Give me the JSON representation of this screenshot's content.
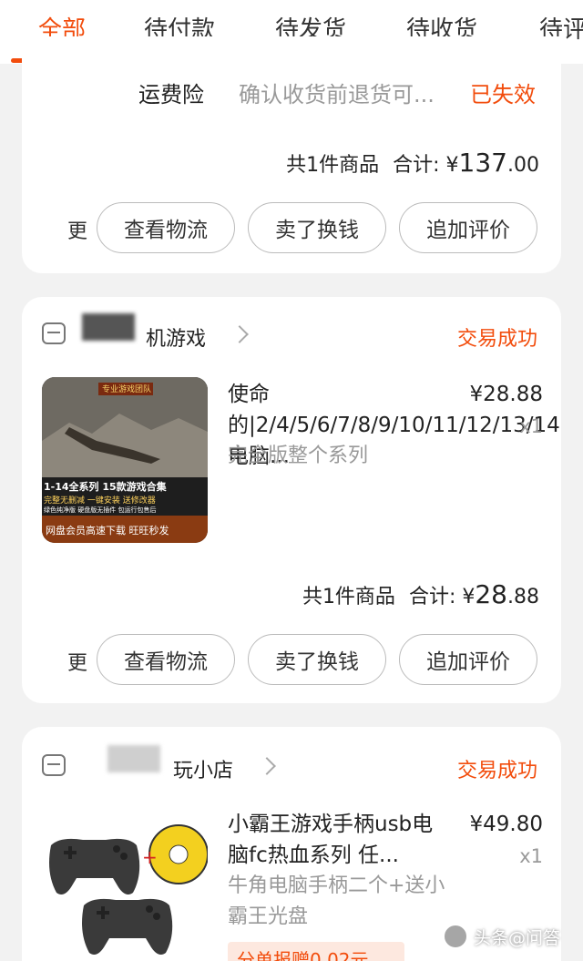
{
  "tabs": [
    "全部",
    "待付款",
    "待发货",
    "待收货",
    "待评"
  ],
  "order1": {
    "insurance_label": "运费险",
    "insurance_desc": "确认收货前退货可...",
    "insurance_status": "已失效",
    "count": "共1件商品",
    "total_label": "合计:",
    "currency": "¥",
    "total_int": "137",
    "total_dec": ".00",
    "more": "更",
    "buttons": [
      "查看物流",
      "卖了换钱",
      "追加评价"
    ]
  },
  "order2": {
    "shop_name": "机游戏",
    "status": "交易成功",
    "title": "使命的|2/4/5/6/7/8/9/10/11/12/13/14|电脑...",
    "subtitle": "完全版整个系列",
    "price": "¥28.88",
    "qty": "x1",
    "thumb": {
      "top": "专业游戏团队",
      "line1": "1-14全系列  15款游戏合集",
      "line2": "完整无删减  一键安装  送修改器",
      "line3": "绿色纯净版  硬盘版无插件  包运行包售后",
      "bottom": "网盘会员高速下载  旺旺秒发"
    },
    "count": "共1件商品",
    "total_label": "合计:",
    "currency": "¥",
    "total_int": "28",
    "total_dec": ".88",
    "more": "更",
    "buttons": [
      "查看物流",
      "卖了换钱",
      "追加评价"
    ]
  },
  "order3": {
    "shop_name": "玩小店",
    "status": "交易成功",
    "title": "小霸王游戏手柄usb电脑fc热血系列 任...",
    "subtitle": "牛角电脑手柄二个+送小霸王光盘",
    "price": "¥49.80",
    "qty": "x1",
    "promo": "分单报赠0.02元"
  },
  "watermark": "头条@问答",
  "colors": {
    "accent": "#f24c0c",
    "muted": "#999999",
    "background": "#f2f2f2"
  }
}
